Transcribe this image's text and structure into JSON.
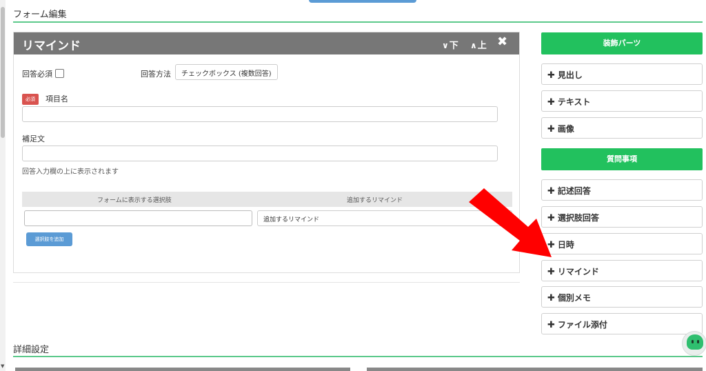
{
  "page": {
    "section_title": "フォーム編集",
    "bottom_section_title": "詳細設定"
  },
  "card": {
    "title": "リマインド",
    "move_down_label": "下",
    "move_up_label": "上",
    "close_icon": "close-icon",
    "required_label": "回答必須",
    "answer_method_label": "回答方法",
    "answer_method_value": "チェックボックス (複数回答)",
    "required_badge": "必須",
    "item_name_label": "項目名",
    "item_name_value": "",
    "supplement_label": "補足文",
    "supplement_value": "",
    "supplement_hint": "回答入力欄の上に表示されます",
    "table_headers": [
      "フォームに表示する選択肢",
      "追加するリマインド"
    ],
    "choice_value": "",
    "remind_select_value": "追加するリマインド",
    "add_choice_button": "選択肢を追加"
  },
  "sidebar": {
    "decor_parts_header": "装飾パーツ",
    "decor_parts": [
      "見出し",
      "テキスト",
      "画像"
    ],
    "question_header": "質問事項",
    "question_items": [
      "記述回答",
      "選択肢回答",
      "日時",
      "リマインド",
      "個別メモ",
      "ファイル添付"
    ],
    "plus_icon": "plus-icon"
  },
  "annotation": {
    "arrow_color": "#ff0000",
    "points_to": "日時"
  },
  "colors": {
    "accent_green": "#22c15e",
    "header_gray": "#777777",
    "button_blue": "#5b9bd5",
    "badge_red": "#d9534f"
  }
}
